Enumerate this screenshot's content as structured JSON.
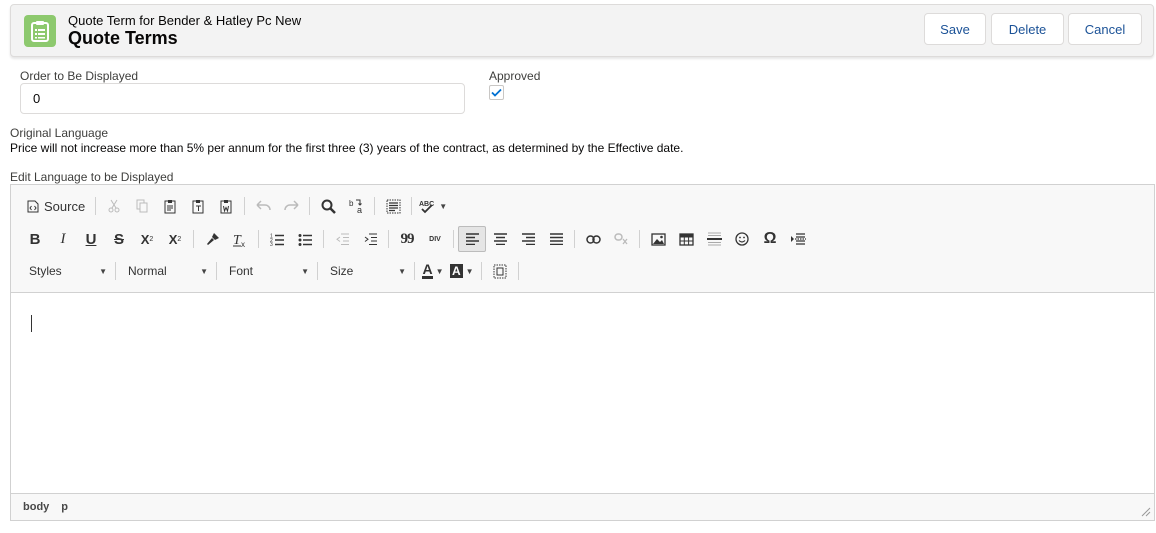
{
  "header": {
    "subtitle": "Quote Term for Bender & Hatley Pc New",
    "title": "Quote Terms",
    "icon": "clipboard-icon",
    "icon_color": "#8dc96e",
    "buttons": {
      "save": "Save",
      "delete": "Delete",
      "cancel": "Cancel"
    }
  },
  "form": {
    "order_label": "Order to Be Displayed",
    "order_value": "0",
    "approved_label": "Approved",
    "approved_checked": true,
    "original_language_label": "Original Language",
    "original_language_text": "Price will not increase more than 5% per annum for the first three (3) years of the contract, as determined by the Effective date.",
    "edit_language_label": "Edit Language to be Displayed"
  },
  "editor": {
    "source_label": "Source",
    "combos": {
      "styles": "Styles",
      "format": "Normal",
      "font": "Font",
      "size": "Size"
    },
    "toolbar_glyphs": {
      "bold": "B",
      "italic": "I",
      "underline": "U",
      "strike": "S",
      "subscript": "X",
      "superscript": "X",
      "quote": "99",
      "omega": "Ω",
      "font_color": "A",
      "bg_color": "A",
      "div": "DIV"
    },
    "status_path": [
      "body",
      "p"
    ]
  }
}
